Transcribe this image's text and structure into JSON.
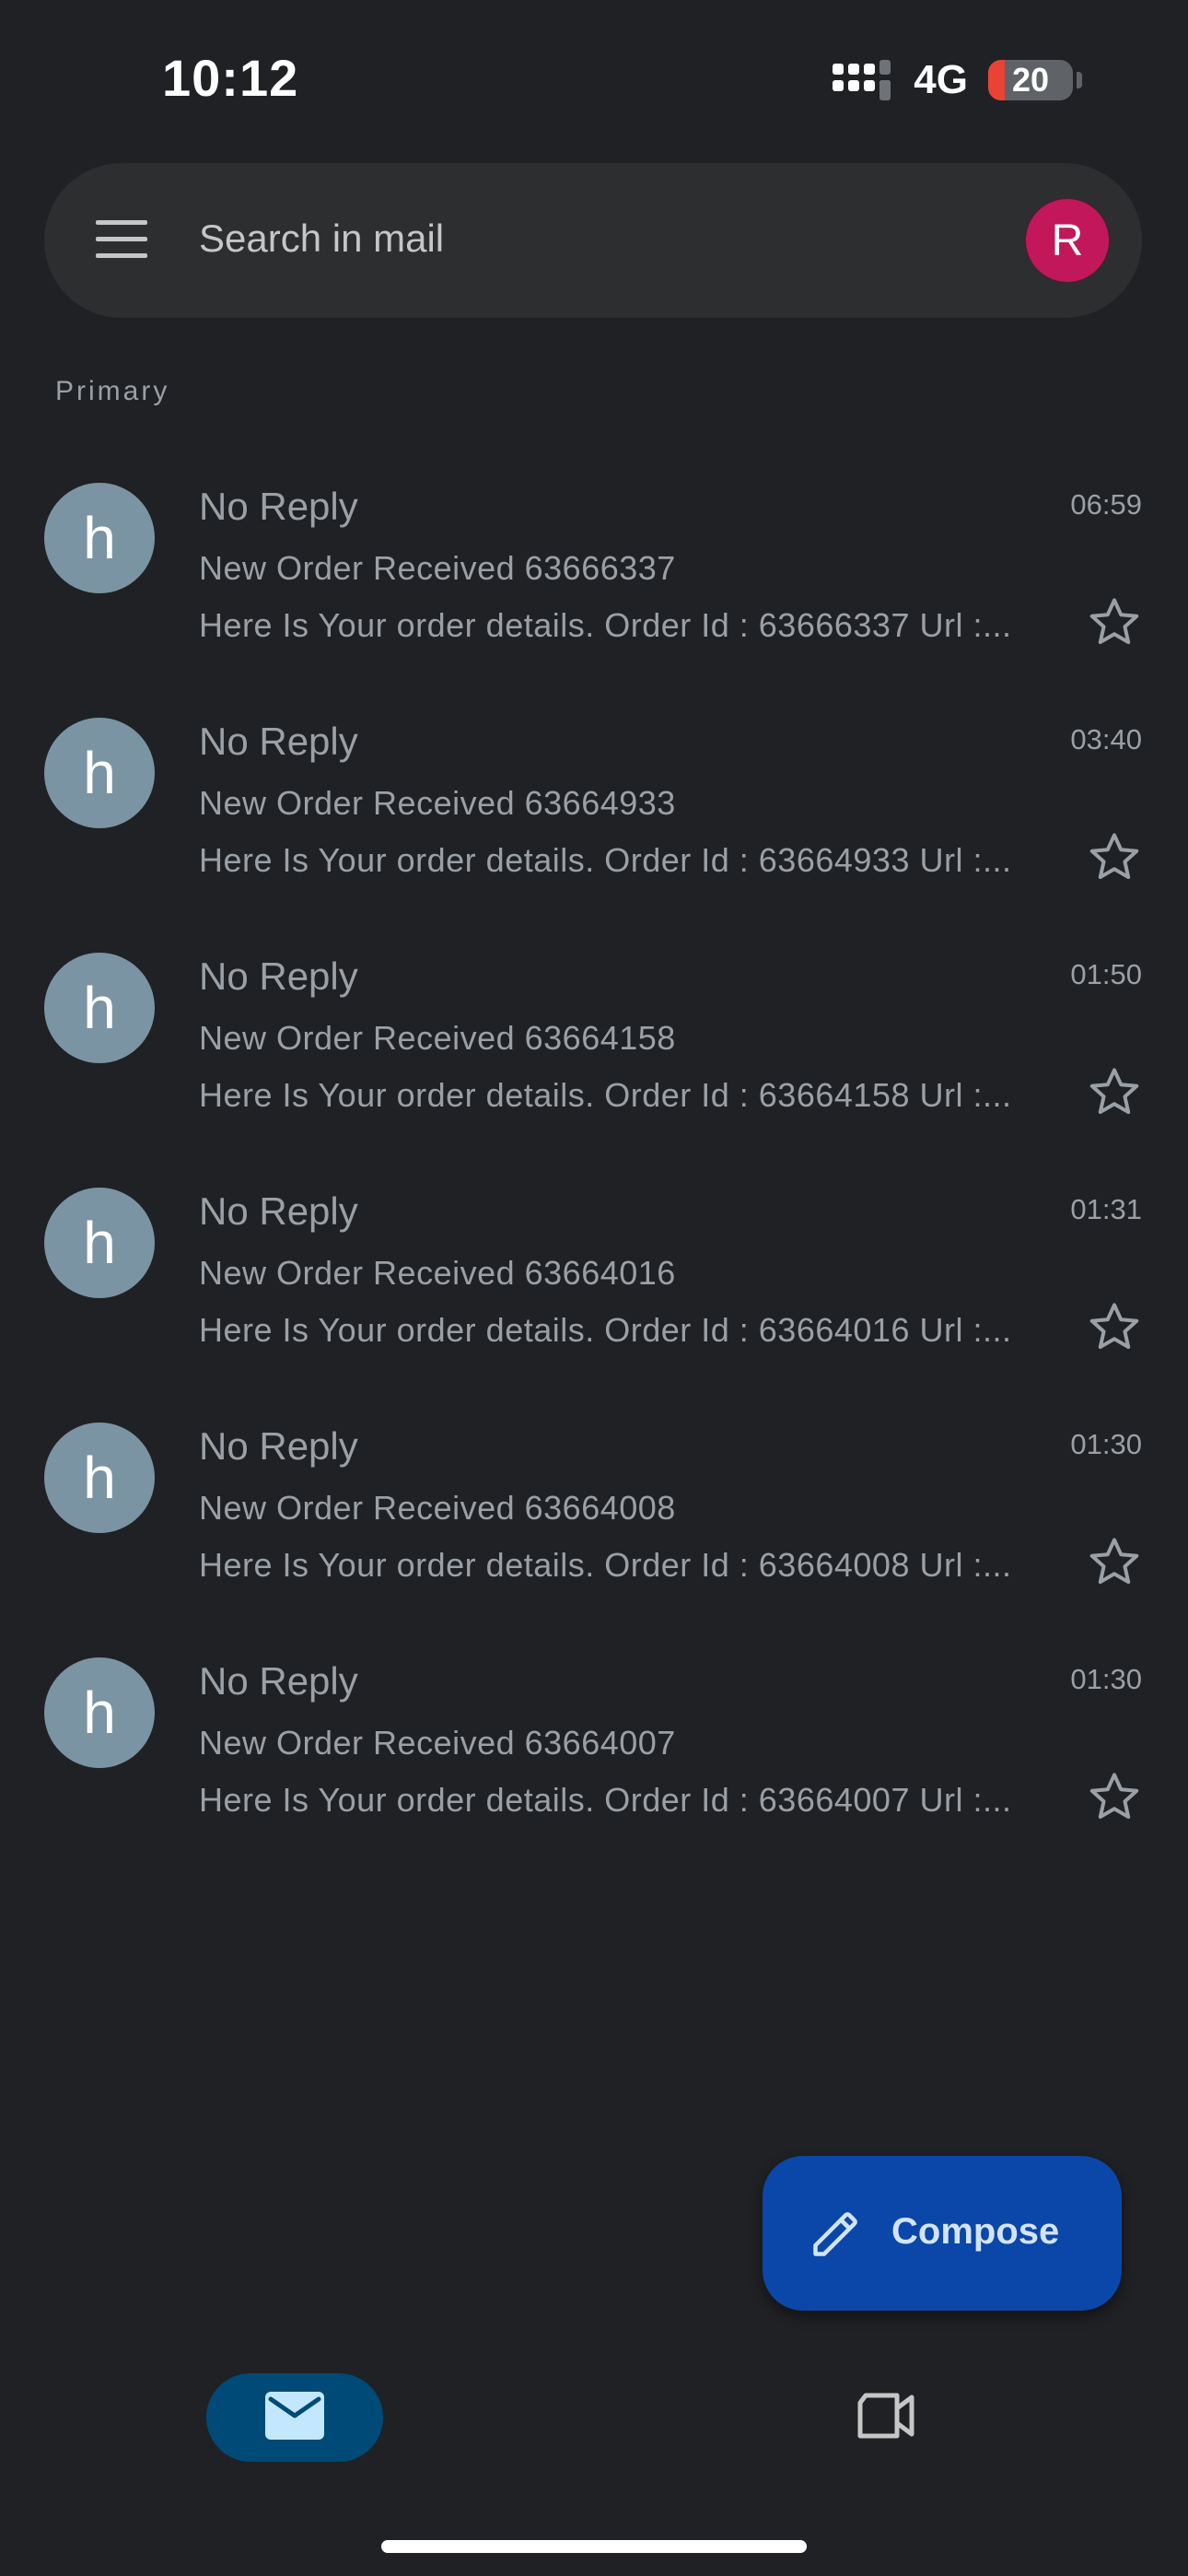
{
  "status_bar": {
    "time": "10:12",
    "network": "4G",
    "battery_percent": "20",
    "battery_level": 0.2,
    "battery_color": "#ea4335"
  },
  "search": {
    "placeholder": "Search in mail",
    "menu_icon": "hamburger-menu-icon",
    "account_initial": "R",
    "account_color": "#c2185b"
  },
  "section": {
    "label": "Primary"
  },
  "emails": [
    {
      "avatar_initial": "h",
      "sender": "No Reply",
      "time": "06:59",
      "subject": "New Order Received 63666337",
      "snippet": "Here Is Your order details. Order Id : 63666337 Url :..."
    },
    {
      "avatar_initial": "h",
      "sender": "No Reply",
      "time": "03:40",
      "subject": "New Order Received 63664933",
      "snippet": "Here Is Your order details. Order Id : 63664933 Url :..."
    },
    {
      "avatar_initial": "h",
      "sender": "No Reply",
      "time": "01:50",
      "subject": "New Order Received 63664158",
      "snippet": "Here Is Your order details. Order Id : 63664158 Url :..."
    },
    {
      "avatar_initial": "h",
      "sender": "No Reply",
      "time": "01:31",
      "subject": "New Order Received 63664016",
      "snippet": "Here Is Your order details. Order Id : 63664016 Url :..."
    },
    {
      "avatar_initial": "h",
      "sender": "No Reply",
      "time": "01:30",
      "subject": "New Order Received 63664008",
      "snippet": "Here Is Your order details. Order Id : 63664008 Url :..."
    },
    {
      "avatar_initial": "h",
      "sender": "No Reply",
      "time": "01:30",
      "subject": "New Order Received 63664007",
      "snippet": "Here Is Your order details. Order Id : 63664007 Url :..."
    }
  ],
  "compose": {
    "label": "Compose",
    "icon": "pencil-icon",
    "color": "#0b47a8"
  },
  "bottom_nav": {
    "mail_icon": "mail-icon",
    "meet_icon": "video-camera-icon",
    "selected": "mail",
    "selected_color": "#004a77"
  }
}
